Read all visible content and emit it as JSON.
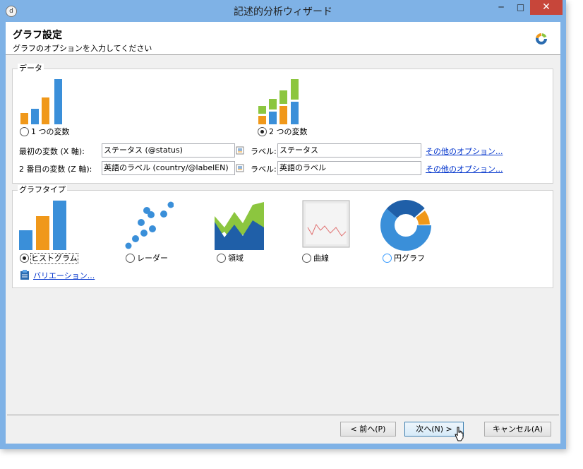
{
  "window": {
    "title": "記述的分析ウィザード",
    "minimize_glyph": "─",
    "maximize_glyph": "□",
    "close_glyph": "✕",
    "app_icon_glyph": "d"
  },
  "header": {
    "title": "グラフ設定",
    "subtitle": "グラフのオプションを入力してください"
  },
  "data_group": {
    "label": "データ",
    "option_one": "1 つの変数",
    "option_two": "2 つの変数",
    "selected": "two",
    "first_var_label": "最初の変数 (X 軸):",
    "first_var_value": "ステータス (@status)",
    "second_var_label": "2 番目の変数 (Z 軸):",
    "second_var_value": "英語のラベル (country/@labelEN)",
    "label_caption": "ラベル:",
    "first_label_value": "ステータス",
    "second_label_value": "英語のラベル",
    "more_options": "その他のオプション..."
  },
  "type_group": {
    "label": "グラフタイプ",
    "types": [
      "ヒストグラム",
      "レーダー",
      "領域",
      "曲線",
      "円グラフ"
    ],
    "selected": "ヒストグラム",
    "variations_link": "バリエーション..."
  },
  "footer": {
    "prev": "< 前へ(P)",
    "next": "次へ(N) >",
    "cancel": "キャンセル(A)"
  },
  "colors": {
    "titlebar": "#7fb2e6",
    "close": "#c7463a",
    "bar_orange": "#f0981a",
    "bar_blue": "#3a8fd9",
    "bar_green": "#8cc63f",
    "dark_blue": "#1f5fa8",
    "link": "#0033cc"
  }
}
